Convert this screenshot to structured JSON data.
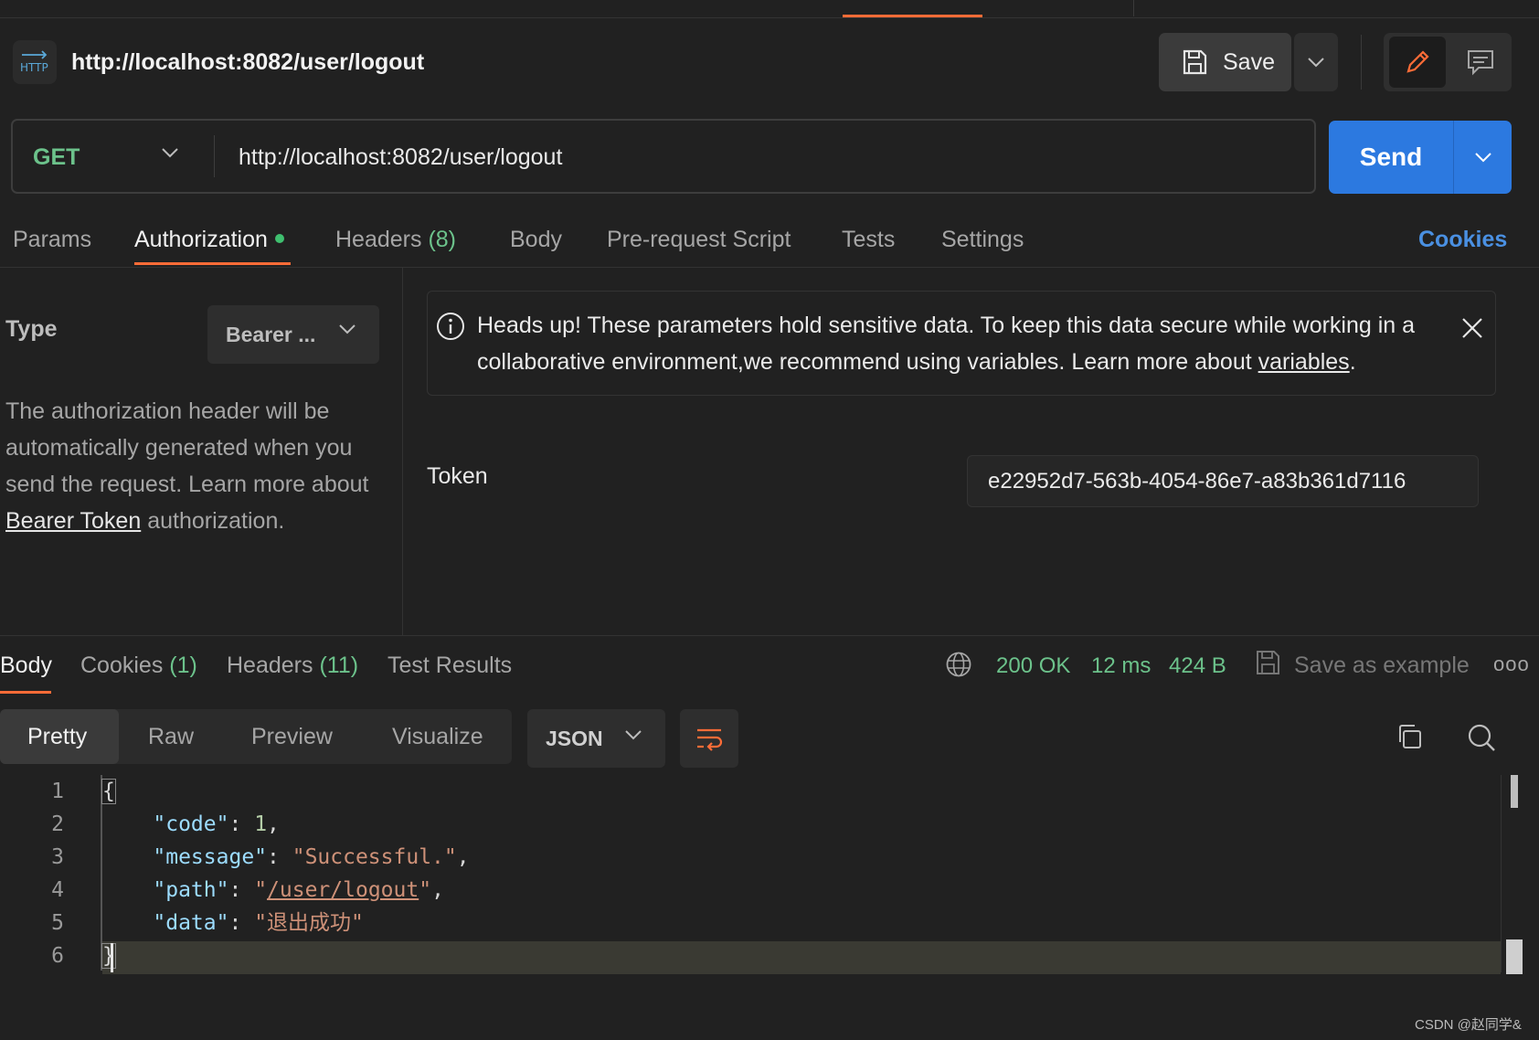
{
  "request": {
    "title": "http://localhost:8082/user/logout",
    "method": "GET",
    "url": "http://localhost:8082/user/logout",
    "save_label": "Save",
    "send_label": "Send"
  },
  "request_tabs": {
    "params": "Params",
    "authorization": "Authorization",
    "headers": "Headers",
    "headers_count": "(8)",
    "body": "Body",
    "prerequest": "Pre-request Script",
    "tests": "Tests",
    "settings": "Settings",
    "cookies": "Cookies"
  },
  "auth": {
    "type_label": "Type",
    "type_value": "Bearer ...",
    "desc_pre": "The authorization header will be automatically generated when you send the request. Learn more about ",
    "desc_link": "Bearer Token",
    "desc_post": " authorization.",
    "notice_pre": "Heads up! These parameters hold sensitive data. To keep this data secure while working in a collaborative environment,we recommend using variables. Learn more about ",
    "notice_link": "variables",
    "notice_post": ".",
    "token_label": "Token",
    "token_value": "e22952d7-563b-4054-86e7-a83b361d7116"
  },
  "response_tabs": {
    "body": "Body",
    "cookies": "Cookies",
    "cookies_count": "(1)",
    "headers": "Headers",
    "headers_count": "(11)",
    "test_results": "Test Results"
  },
  "response_status": {
    "status": "200 OK",
    "time": "12 ms",
    "size": "424 B",
    "save_example": "Save as example",
    "more": "ooo"
  },
  "view_modes": [
    "Pretty",
    "Raw",
    "Preview",
    "Visualize"
  ],
  "format": "JSON",
  "code": {
    "line_numbers": [
      "1",
      "2",
      "3",
      "4",
      "5",
      "6"
    ],
    "open_brace": "{",
    "close_brace": "}",
    "k_code": "\"code\"",
    "v_code": "1",
    "k_message": "\"message\"",
    "v_message": "\"Successful.\"",
    "k_path": "\"path\"",
    "v_path_open": "\"",
    "v_path": "/user/logout",
    "v_path_close": "\"",
    "k_data": "\"data\"",
    "v_data": "\"退出成功\""
  },
  "watermark": "CSDN @赵同学&",
  "colors": {
    "accent": "#ff6c37",
    "send": "#2c79e0",
    "success": "#6cc28b",
    "link": "#4a90e2"
  },
  "icons": [
    "http-icon",
    "save-icon",
    "chevron-down-icon",
    "pencil-icon",
    "comment-icon",
    "info-icon",
    "close-icon",
    "globe-icon",
    "copy-icon",
    "search-icon",
    "wrap-icon"
  ]
}
